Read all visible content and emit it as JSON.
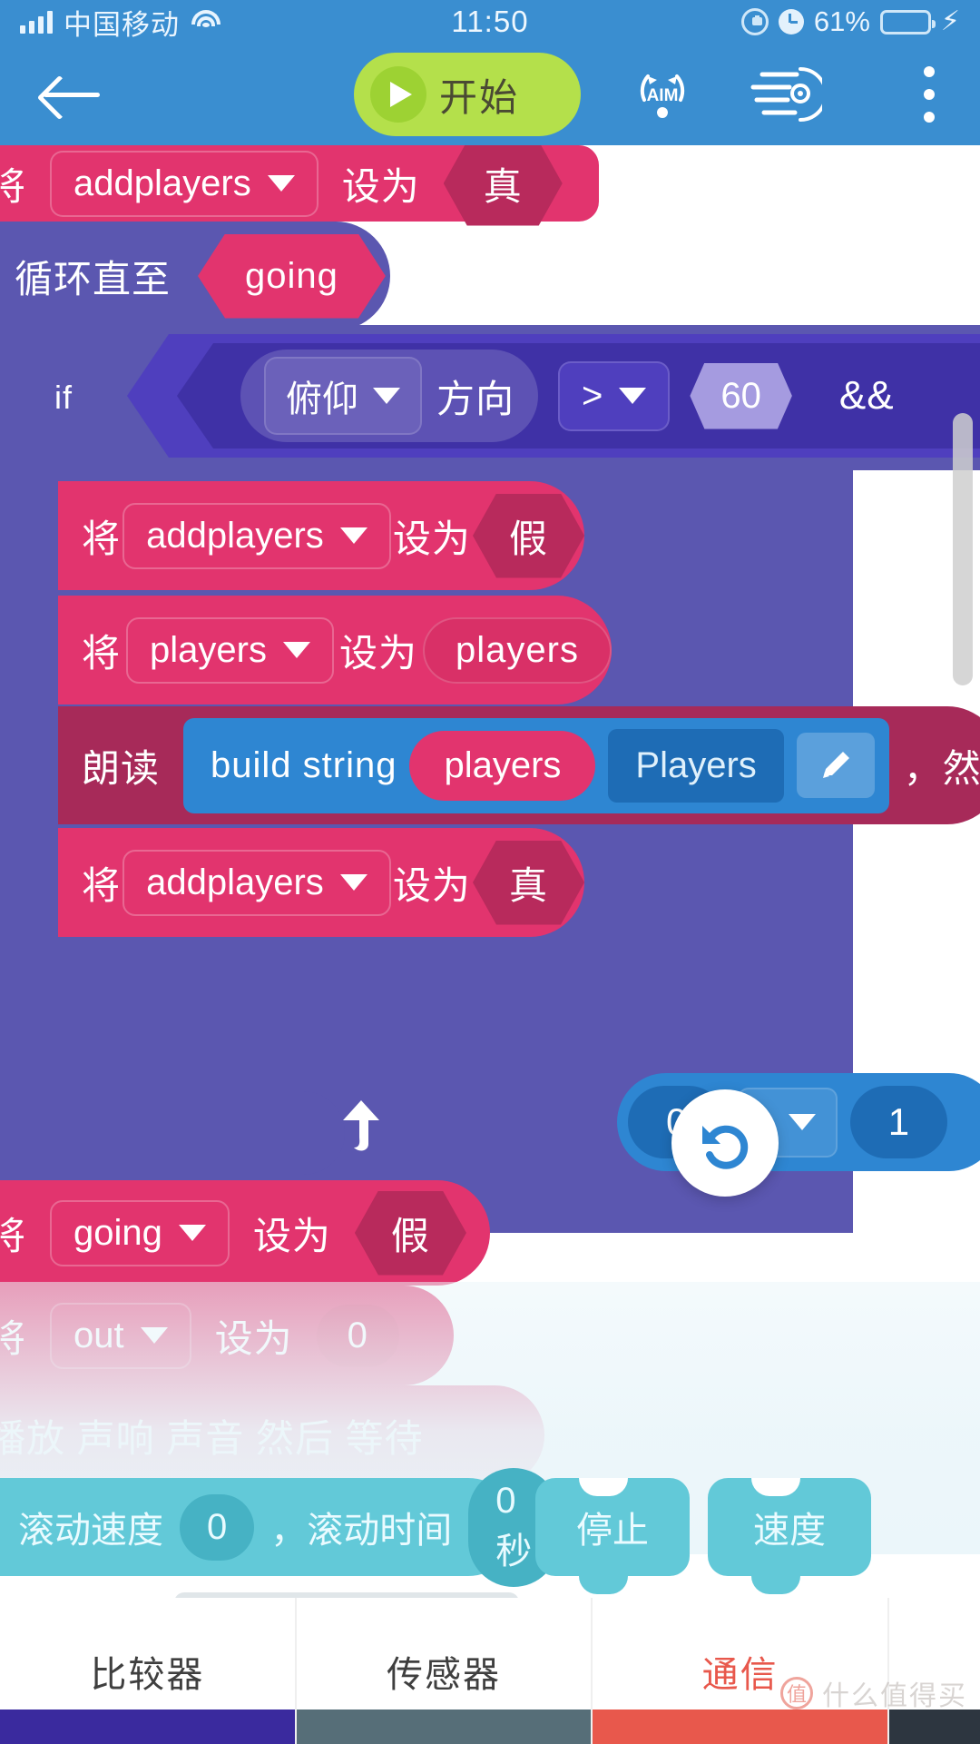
{
  "status_bar": {
    "carrier": "中国移动",
    "time": "11:50",
    "battery_percent": "61%",
    "icons": [
      "signal-icon",
      "wifi-icon",
      "rotation-lock-icon",
      "alarm-icon",
      "battery-icon",
      "charging-bolt-icon"
    ]
  },
  "toolbar": {
    "back_label": "back-arrow-icon",
    "start_label": "开始",
    "aim_label": "AIM",
    "menu_icon": "speed-lines-icon",
    "more_icon": "kebab-menu-icon"
  },
  "workspace": {
    "blocks": {
      "set_addplayers_true_top": {
        "keyword": "将",
        "variable": "addplayers",
        "setto": "设为",
        "value": "真"
      },
      "repeat_until": {
        "keyword": "循环直至",
        "condition": "going"
      },
      "if_row": {
        "keyword": "if",
        "sensor": "俯仰",
        "sensor_unit": "方向",
        "operator": ">",
        "number": "60",
        "trailing": "&&"
      },
      "set_addplayers_false": {
        "keyword": "将",
        "variable": "addplayers",
        "setto": "设为",
        "value": "假"
      },
      "set_players_players": {
        "keyword": "将",
        "variable": "players",
        "setto": "设为",
        "value": "players"
      },
      "speak_row": {
        "keyword": "朗读",
        "build_string": "build string",
        "arg1": "players",
        "arg2": "Players",
        "edit_icon": "pencil-icon",
        "trailing": "，然"
      },
      "set_addplayers_true": {
        "keyword": "将",
        "variable": "addplayers",
        "setto": "设为",
        "value": "真"
      },
      "set_going_false": {
        "keyword": "将",
        "variable": "going",
        "setto": "设为",
        "value": "假"
      },
      "ghost_set_out": {
        "keyword": "将",
        "variable": "out",
        "setto": "设为",
        "value": "0"
      },
      "ghost_play": {
        "text": "播放  声响  声音  然后   等待"
      },
      "math_block": {
        "left": "0",
        "operator": "-",
        "right": "1"
      },
      "palette_scroll": {
        "prefix": "，滚动速度",
        "speed": "0",
        "middle": "，滚动时间",
        "time": "0秒"
      },
      "palette_stop": "停止",
      "palette_speed": "速度"
    },
    "undo_button": "undo-icon",
    "loop_arrow": "loop-back-arrow-icon"
  },
  "tabs": [
    {
      "label": "比较器",
      "color": "#3a2a9e",
      "active": false
    },
    {
      "label": "传感器",
      "color": "#566e78",
      "active": false
    },
    {
      "label": "通信",
      "color": "#e8584c",
      "active": true
    },
    {
      "label": "",
      "color": "#2d3640",
      "active": false
    }
  ],
  "watermark": {
    "badge": "值",
    "text": "什么值得买"
  },
  "colors": {
    "header_blue": "#3a8ed0",
    "start_green": "#b4e04b",
    "block_pink": "#e2346e",
    "block_purple": "#5b57b0",
    "block_blue": "#2e86d2",
    "block_cyan": "#62c9d8",
    "active_tab": "#e8584c"
  }
}
